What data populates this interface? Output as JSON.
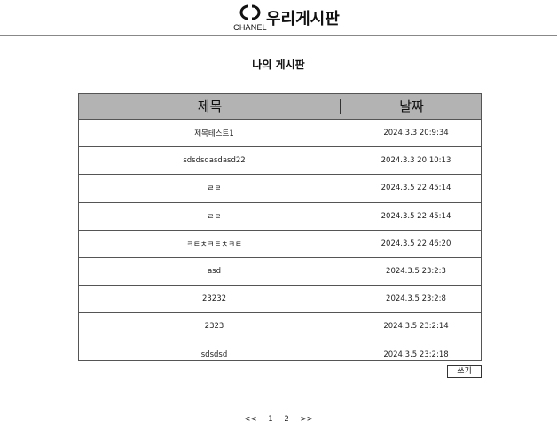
{
  "header": {
    "logo_text": "CHANEL",
    "site_title": "우리게시판"
  },
  "page_title": "나의 게시판",
  "board": {
    "columns": {
      "title": "제목",
      "date": "날짜"
    },
    "rows": [
      {
        "title": "제목테스트1",
        "date": "2024.3.3 20:9:34"
      },
      {
        "title": "sdsdsdasdasd22",
        "date": "2024.3.3 20:10:13"
      },
      {
        "title": "ㄹㄹ",
        "date": "2024.3.5 22:45:14"
      },
      {
        "title": "ㄹㄹ",
        "date": "2024.3.5 22:45:14"
      },
      {
        "title": "ㅋㅌㅊㅋㅌㅊㅋㅌ",
        "date": "2024.3.5 22:46:20"
      },
      {
        "title": "asd",
        "date": "2024.3.5 23:2:3"
      },
      {
        "title": "23232",
        "date": "2024.3.5 23:2:8"
      },
      {
        "title": "2323",
        "date": "2024.3.5 23:2:14"
      },
      {
        "title": "sdsdsd",
        "date": "2024.3.5 23:2:18"
      }
    ]
  },
  "write_button": "쓰기",
  "pagination": {
    "prev": "<<",
    "pages": [
      "1",
      "2"
    ],
    "next": ">>"
  }
}
